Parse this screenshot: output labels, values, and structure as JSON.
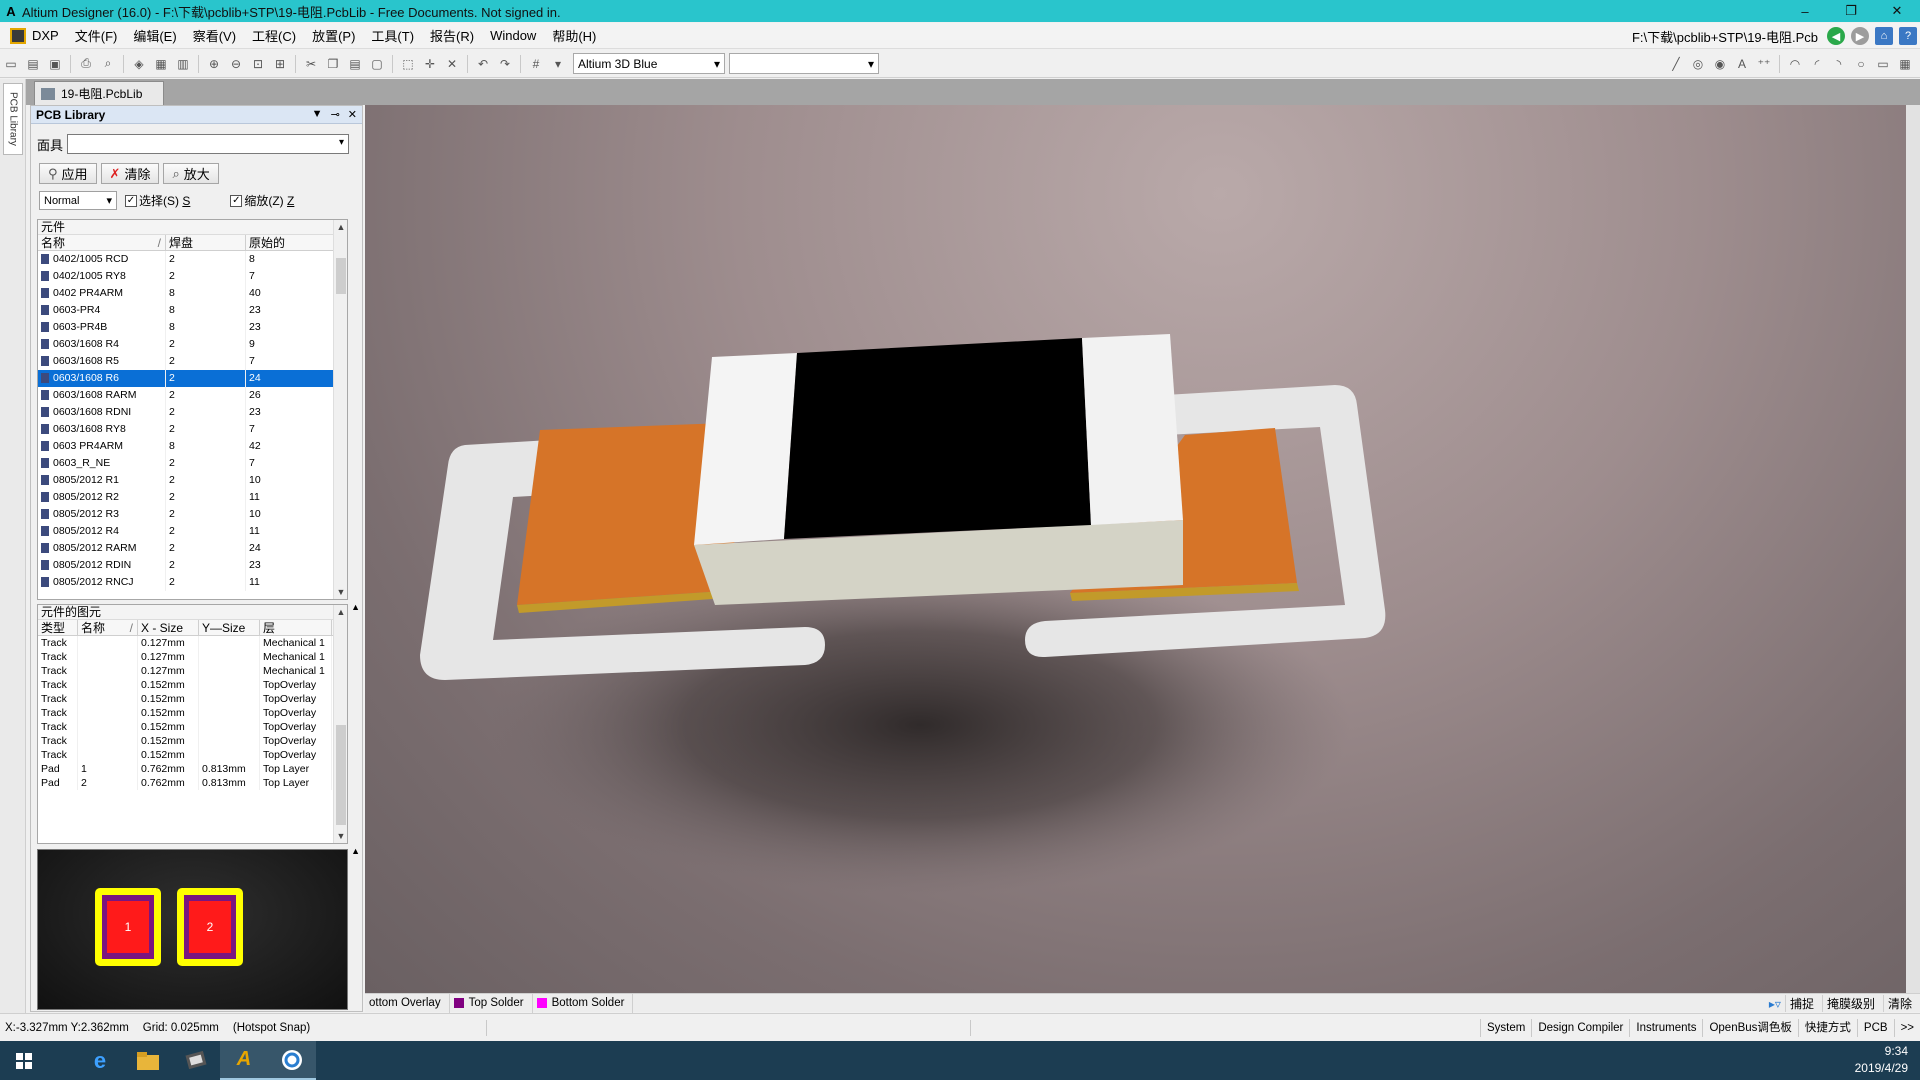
{
  "window": {
    "title": "Altium Designer (16.0) - F:\\下载\\pcblib+STP\\19-电阻.PcbLib - Free Documents. Not signed in.",
    "controls": {
      "minimize": "–",
      "maximize": "❐",
      "close": "✕"
    }
  },
  "menu": {
    "items": [
      "DXP",
      "文件(F)",
      "编辑(E)",
      "察看(V)",
      "工程(C)",
      "放置(P)",
      "工具(T)",
      "报告(R)",
      "Window",
      "帮助(H)"
    ],
    "doc_path": "F:\\下载\\pcblib+STP\\19-电阻.Pcb"
  },
  "toolbar": {
    "view_config": "Altium 3D Blue",
    "second_select": ""
  },
  "side_strip": {
    "tab_label": "PCB Library"
  },
  "doc_tab": {
    "label": "19-电阻.PcbLib"
  },
  "panel": {
    "title": "PCB Library",
    "mask_label": "面具",
    "mask_value": "",
    "buttons": {
      "apply": "应用",
      "clear": "清除",
      "zoom": "放大"
    },
    "mode_select": "Normal",
    "select_check": "选择(S)",
    "select_check_hint": "S",
    "zoom_check": "缩放(Z)",
    "zoom_check_hint": "Z",
    "components": {
      "section_title": "元件",
      "columns": [
        "名称",
        "焊盘",
        "原始的"
      ],
      "rows": [
        [
          "0402/1005 RCD",
          "2",
          "8"
        ],
        [
          "0402/1005 RY8",
          "2",
          "7"
        ],
        [
          "0402 PR4ARM",
          "8",
          "40"
        ],
        [
          "0603-PR4",
          "8",
          "23"
        ],
        [
          "0603-PR4B",
          "8",
          "23"
        ],
        [
          "0603/1608 R4",
          "2",
          "9"
        ],
        [
          "0603/1608 R5",
          "2",
          "7"
        ],
        [
          "0603/1608 R6",
          "2",
          "24"
        ],
        [
          "0603/1608 RARM",
          "2",
          "26"
        ],
        [
          "0603/1608 RDNI",
          "2",
          "23"
        ],
        [
          "0603/1608 RY8",
          "2",
          "7"
        ],
        [
          "0603 PR4ARM",
          "8",
          "42"
        ],
        [
          "0603_R_NE",
          "2",
          "7"
        ],
        [
          "0805/2012 R1",
          "2",
          "10"
        ],
        [
          "0805/2012 R2",
          "2",
          "11"
        ],
        [
          "0805/2012 R3",
          "2",
          "10"
        ],
        [
          "0805/2012 R4",
          "2",
          "11"
        ],
        [
          "0805/2012 RARM",
          "2",
          "24"
        ],
        [
          "0805/2012 RDIN",
          "2",
          "23"
        ],
        [
          "0805/2012 RNCJ",
          "2",
          "11"
        ]
      ],
      "selected_index": 7
    },
    "primitives": {
      "section_title": "元件的图元",
      "columns": [
        "类型",
        "名称",
        "X - Size",
        "Y—Size",
        "层"
      ],
      "rows": [
        [
          "Track",
          "",
          "0.127mm",
          "",
          "Mechanical 1"
        ],
        [
          "Track",
          "",
          "0.127mm",
          "",
          "Mechanical 1"
        ],
        [
          "Track",
          "",
          "0.127mm",
          "",
          "Mechanical 1"
        ],
        [
          "Track",
          "",
          "0.152mm",
          "",
          "TopOverlay"
        ],
        [
          "Track",
          "",
          "0.152mm",
          "",
          "TopOverlay"
        ],
        [
          "Track",
          "",
          "0.152mm",
          "",
          "TopOverlay"
        ],
        [
          "Track",
          "",
          "0.152mm",
          "",
          "TopOverlay"
        ],
        [
          "Track",
          "",
          "0.152mm",
          "",
          "TopOverlay"
        ],
        [
          "Track",
          "",
          "0.152mm",
          "",
          "TopOverlay"
        ],
        [
          "Pad",
          "1",
          "0.762mm",
          "0.813mm",
          "Top Layer"
        ],
        [
          "Pad",
          "2",
          "0.762mm",
          "0.813mm",
          "Top Layer"
        ]
      ]
    },
    "preview": {
      "pad1": "1",
      "pad2": "2",
      "pad_fill": "#ff1a1a",
      "pad_ring": "#ffff00"
    }
  },
  "layer_tabs": [
    {
      "label": "ottom Overlay",
      "color": ""
    },
    {
      "label": "Top Solder",
      "color": "#800080"
    },
    {
      "label": "Bottom Solder",
      "color": "#ff00ff"
    }
  ],
  "layer_right": {
    "snap": "捕捉",
    "mask_level": "掩膜级别",
    "clear": "清除"
  },
  "status": {
    "coords": "X:-3.327mm Y:2.362mm",
    "grid": "Grid: 0.025mm",
    "snap": "(Hotspot Snap)",
    "panels": [
      "System",
      "Design Compiler",
      "Instruments",
      "OpenBus调色板",
      "快捷方式",
      "PCB",
      ">>"
    ]
  },
  "taskbar": {
    "time": "9:34",
    "date": "2019/4/29",
    "apps": [
      "start-icon",
      "edge-icon",
      "explorer-icon",
      "app-icon",
      "altium-icon",
      "browser-icon"
    ]
  },
  "viewport": {
    "background": "#9e8d8e",
    "body_color": "#d4d3c6",
    "top_color": "#000000",
    "pad_color": "#d67428",
    "overlay_color": "#e6e6e6"
  }
}
